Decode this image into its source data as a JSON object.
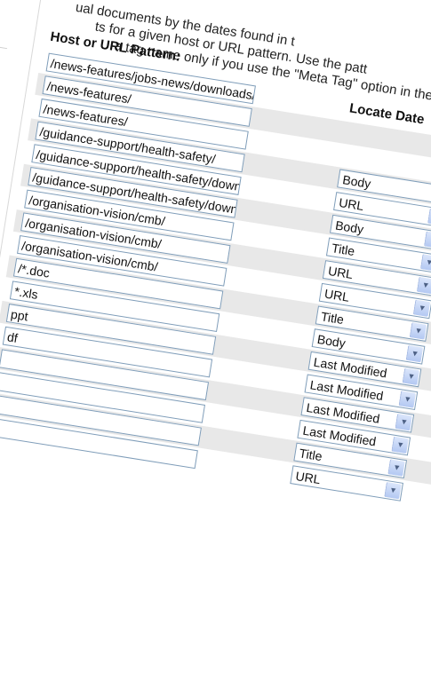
{
  "intro_lines": [
    "ual documents by the dates found in t",
    "ts for a given host or URL pattern. Use the patt",
    "a tag name only if you use the \"Meta Tag\" option in the dr"
  ],
  "columns": {
    "pattern_header": "Host or URL Pattern:",
    "locate_header": "Locate Date"
  },
  "rows": [
    {
      "pattern": "/news-features/jobs-news/downloads/",
      "locate": ""
    },
    {
      "pattern": "/news-features/",
      "locate": ""
    },
    {
      "pattern": "/news-features/",
      "locate": ""
    },
    {
      "pattern": "/guidance-support/health-safety/",
      "locate": "Body"
    },
    {
      "pattern": "/guidance-support/health-safety/download",
      "locate": "URL"
    },
    {
      "pattern": "/guidance-support/health-safety/download",
      "locate": "Body"
    },
    {
      "pattern": "/organisation-vision/cmb/",
      "locate": "Title"
    },
    {
      "pattern": "/organisation-vision/cmb/",
      "locate": "URL"
    },
    {
      "pattern": "/organisation-vision/cmb/",
      "locate": "URL"
    },
    {
      "pattern": "/*.doc",
      "locate": "Title"
    },
    {
      "pattern": "*.xls",
      "locate": "Body"
    },
    {
      "pattern": "ppt",
      "locate": "Last Modified"
    },
    {
      "pattern": "df",
      "locate": "Last Modified"
    },
    {
      "pattern": "",
      "locate": "Last Modified"
    },
    {
      "pattern": "",
      "locate": "Last Modified"
    },
    {
      "pattern": "",
      "locate": "Title"
    },
    {
      "pattern": "",
      "locate": "URL"
    }
  ],
  "colors": {
    "input_border": "#7f9db9",
    "row_shade": "#e8e8e8",
    "arrow_bg": "#c5d5f5"
  }
}
